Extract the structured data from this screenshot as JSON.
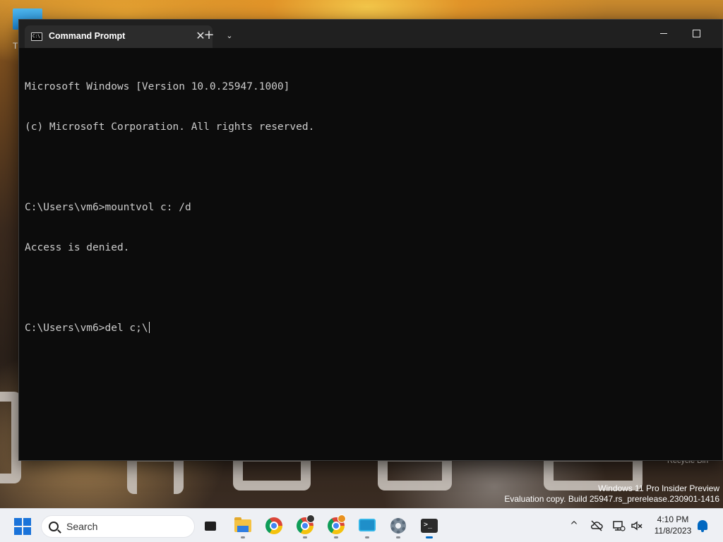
{
  "desktop": {
    "icon_letter": "T",
    "recycle_bin_label": "Recycle Bin",
    "watermark_line1": "Windows 11 Pro Insider Preview",
    "watermark_line2": "Evaluation copy. Build 25947.rs_prerelease.230901-1416"
  },
  "window": {
    "tab_title": "Command Prompt",
    "tab_icon_text": "C:\\",
    "close_tab_glyph": "✕",
    "new_tab_glyph": "+",
    "dropdown_glyph": "⌄"
  },
  "console": {
    "lines": [
      "Microsoft Windows [Version 10.0.25947.1000]",
      "(c) Microsoft Corporation. All rights reserved.",
      "",
      "C:\\Users\\vm6>mountvol c: /d",
      "Access is denied.",
      "",
      "C:\\Users\\vm6>del c;\\"
    ]
  },
  "taskbar": {
    "search_label": "Search",
    "apps": [
      "task-view",
      "file-explorer",
      "chrome",
      "chrome-profile-1",
      "chrome-profile-2",
      "touch-keyboard",
      "settings",
      "terminal"
    ],
    "terminal_glyph": ">_",
    "tray": {
      "chevron_glyph": "^",
      "clock_time": "4:10 PM",
      "clock_date": "11/8/2023"
    }
  },
  "colors": {
    "console_bg": "#0c0c0c",
    "console_text": "#cccccc",
    "titlebar": "#202020",
    "taskbar": "#eef0f4",
    "accent": "#0067c0"
  }
}
